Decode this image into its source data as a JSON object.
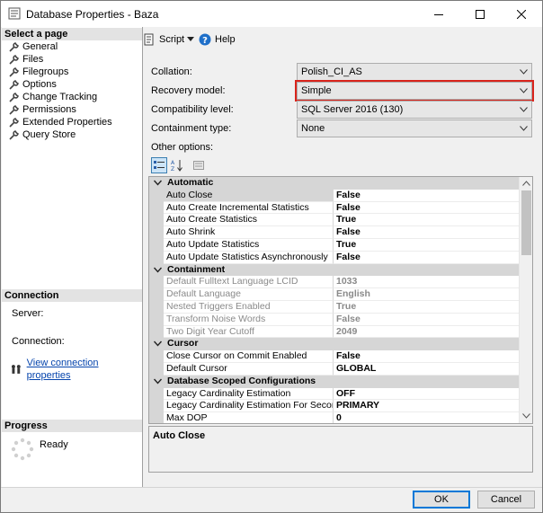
{
  "window": {
    "title": "Database Properties - Baza"
  },
  "left": {
    "select_header": "Select a page",
    "pages": [
      "General",
      "Files",
      "Filegroups",
      "Options",
      "Change Tracking",
      "Permissions",
      "Extended Properties",
      "Query Store"
    ],
    "connection_header": "Connection",
    "server_label": "Server:",
    "connection_label": "Connection:",
    "view_link": "View connection properties",
    "progress_header": "Progress",
    "progress_status": "Ready"
  },
  "toolbar": {
    "script_label": "Script",
    "help_label": "Help"
  },
  "form": {
    "collation_label": "Collation:",
    "collation_value": "Polish_CI_AS",
    "recovery_label": "Recovery model:",
    "recovery_value": "Simple",
    "compat_label": "Compatibility level:",
    "compat_value": "SQL Server 2016 (130)",
    "containment_label": "Containment type:",
    "containment_value": "None",
    "other_options_label": "Other options:"
  },
  "grid": {
    "categories": [
      {
        "name": "Automatic",
        "rows": [
          {
            "name": "Auto Close",
            "value": "False",
            "selected": true
          },
          {
            "name": "Auto Create Incremental Statistics",
            "value": "False"
          },
          {
            "name": "Auto Create Statistics",
            "value": "True"
          },
          {
            "name": "Auto Shrink",
            "value": "False"
          },
          {
            "name": "Auto Update Statistics",
            "value": "True"
          },
          {
            "name": "Auto Update Statistics Asynchronously",
            "value": "False"
          }
        ]
      },
      {
        "name": "Containment",
        "rows": [
          {
            "name": "Default Fulltext Language LCID",
            "value": "1033",
            "disabled": true
          },
          {
            "name": "Default Language",
            "value": "English",
            "disabled": true
          },
          {
            "name": "Nested Triggers Enabled",
            "value": "True",
            "disabled": true
          },
          {
            "name": "Transform Noise Words",
            "value": "False",
            "disabled": true
          },
          {
            "name": "Two Digit Year Cutoff",
            "value": "2049",
            "disabled": true
          }
        ]
      },
      {
        "name": "Cursor",
        "rows": [
          {
            "name": "Close Cursor on Commit Enabled",
            "value": "False"
          },
          {
            "name": "Default Cursor",
            "value": "GLOBAL"
          }
        ]
      },
      {
        "name": "Database Scoped Configurations",
        "rows": [
          {
            "name": "Legacy Cardinality Estimation",
            "value": "OFF"
          },
          {
            "name": "Legacy Cardinality Estimation For Secondary",
            "value": "PRIMARY"
          },
          {
            "name": "Max DOP",
            "value": "0"
          }
        ]
      }
    ],
    "description_title": "Auto Close"
  },
  "buttons": {
    "ok": "OK",
    "cancel": "Cancel"
  },
  "colors": {
    "highlight_border": "#d9241c",
    "link": "#0645ad",
    "default_button_border": "#0078d7"
  }
}
